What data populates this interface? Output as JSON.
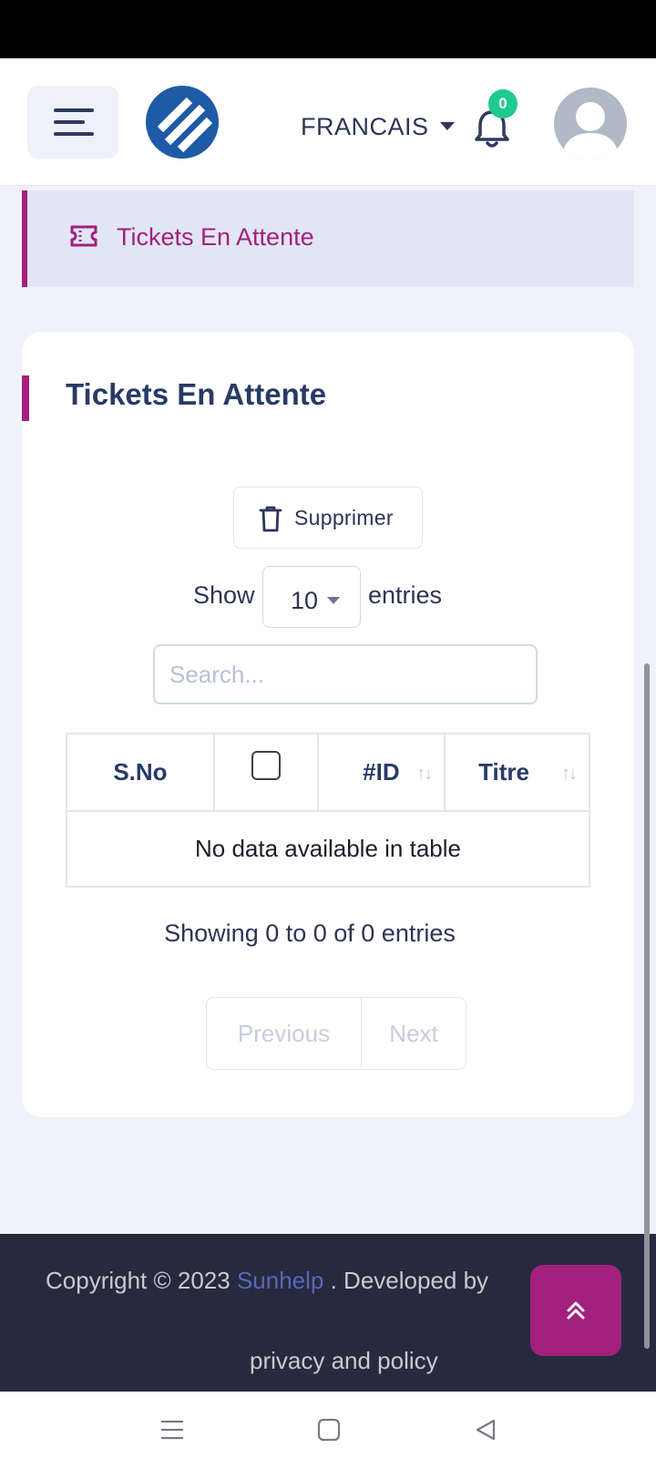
{
  "header": {
    "language": "FRANCAIS",
    "notification_count": "0"
  },
  "breadcrumb": {
    "label": "Tickets En Attente"
  },
  "card": {
    "title": "Tickets En Attente",
    "delete_label": "Supprimer",
    "show_label": "Show",
    "entries_value": "10",
    "entries_label": "entries",
    "search_placeholder": "Search...",
    "table": {
      "columns": [
        "S.No",
        "",
        "#ID",
        "Titre"
      ],
      "empty_message": "No data available in table"
    },
    "showing_info": "Showing 0 to 0 of 0 entries",
    "pagination": {
      "previous": "Previous",
      "next": "Next"
    }
  },
  "footer": {
    "copyright": "Copyright © 2023",
    "brand": "Sunhelp",
    "developed_by": ". Developed by",
    "privacy": "privacy and policy"
  },
  "colors": {
    "accent": "#a3207e",
    "header_text": "#283a66",
    "badge": "#1fc98f",
    "footer_bg": "#252a3e",
    "logo_blue": "#1f5aa6"
  },
  "icons": {
    "menu": "hamburger-icon",
    "logo": "sunhelp-logo",
    "bell": "bell-icon",
    "avatar": "user-avatar",
    "breadcrumb": "ticket-icon",
    "delete": "trash-icon",
    "scroll_top": "chevrons-up-icon"
  }
}
